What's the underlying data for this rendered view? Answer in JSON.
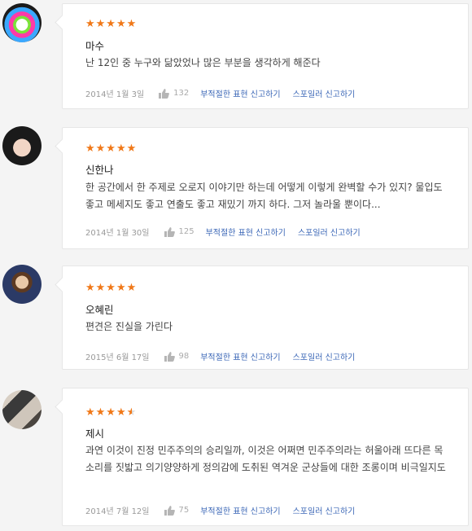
{
  "reviews": [
    {
      "stars": "★★★★★",
      "name": "마수",
      "text": "난 12인 중 누구와 닮았었나 많은 부분을 생각하게 해준다",
      "date": "2014년 1월 3일",
      "likes": "132",
      "report_language": "부적절한 표현 신고하기",
      "report_spoiler": "스포일러 신고하기"
    },
    {
      "stars": "★★★★★",
      "name": "신한나",
      "text": "한 공간에서 한 주제로 오로지 이야기만 하는데 어떻게 이렇게 완벽할 수가 있지? 물입도 좋고 메세지도 좋고 연출도 좋고 재밌기 까지 하다. 그저 놀라울 뿐이다...",
      "date": "2014년 1월 30일",
      "likes": "125",
      "report_language": "부적절한 표현 신고하기",
      "report_spoiler": "스포일러 신고하기"
    },
    {
      "stars": "★★★★★",
      "name": "오혜린",
      "text": "편견은 진실을 가린다",
      "date": "2015년 6월 17일",
      "likes": "98",
      "report_language": "부적절한 표현 신고하기",
      "report_spoiler": "스포일러 신고하기"
    },
    {
      "stars": "★★★★",
      "half_star": "★",
      "name": "제시",
      "text": "과연 이것이 진정 민주주의의 승리일까, 이것은 어쩌면 민주주의라는 허울아래 뜨다른 목소리를 짓밟고 의기양양하게 정의감에 도취된 역겨운 군상들에 대한 조롱이며 비극일지도",
      "date": "2014년 7월 12일",
      "likes": "75",
      "report_language": "부적절한 표현 신고하기",
      "report_spoiler": "스포일러 신고하기"
    }
  ],
  "colors": {
    "star": "#f07818",
    "link": "#3a66b6",
    "meta": "#999999"
  }
}
